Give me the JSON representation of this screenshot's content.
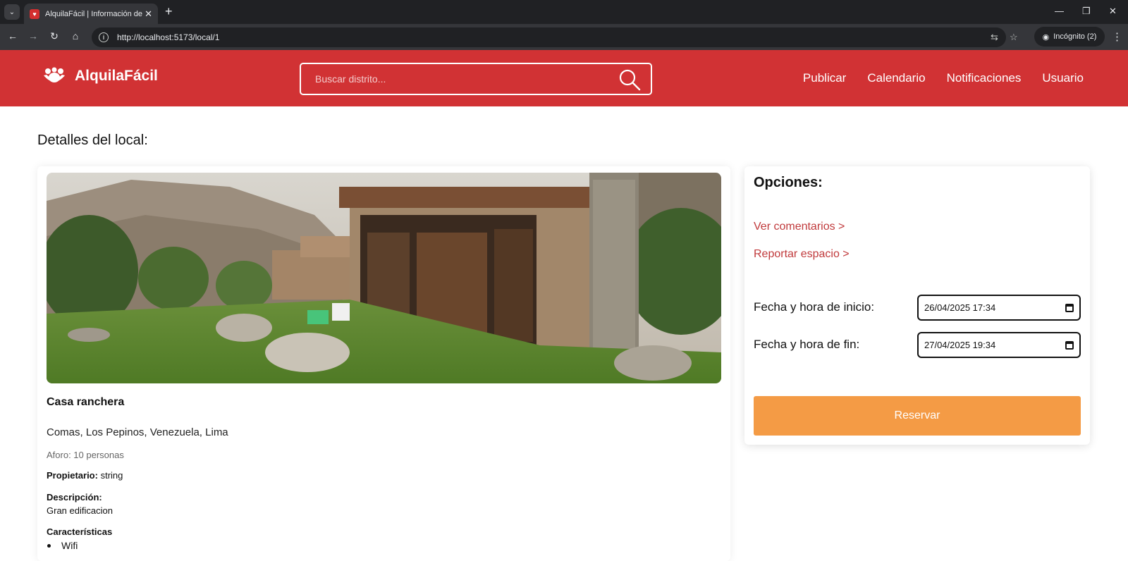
{
  "browser": {
    "tab_title": "AlquilaFácil | Información de es",
    "url": "http://localhost:5173/local/1",
    "incognito_label": "Incógnito (2)"
  },
  "header": {
    "brand": "AlquilaFácil",
    "search_placeholder": "Buscar distrito...",
    "nav": [
      "Publicar",
      "Calendario",
      "Notificaciones",
      "Usuario"
    ],
    "brand_color": "#d13234"
  },
  "page": {
    "title": "Detalles del local:"
  },
  "local": {
    "name": "Casa ranchera",
    "address": "Comas, Los Pepinos, Venezuela, Lima",
    "capacity": "Aforo: 10 personas",
    "owner_label": "Propietario:",
    "owner_value": "string",
    "description_label": "Descripción:",
    "description": "Gran edificacion",
    "features_label": "Características",
    "features": [
      "Wifi"
    ]
  },
  "options": {
    "title": "Opciones:",
    "comments_link": "Ver comentarios >",
    "report_link": "Reportar espacio >",
    "start_label": "Fecha y hora de inicio:",
    "start_value": "26/04/2025 17:34",
    "end_label": "Fecha y hora de fin:",
    "end_value": "27/04/2025 19:34",
    "reserve_button": "Reservar",
    "link_color": "#c0393b",
    "button_color": "#f49b45"
  }
}
